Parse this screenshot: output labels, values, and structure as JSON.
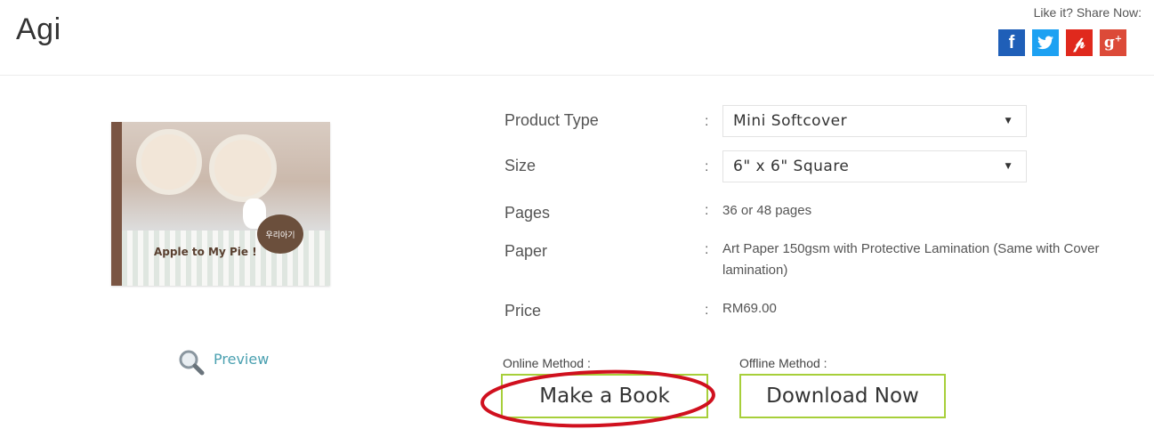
{
  "page": {
    "title": "Agi"
  },
  "share": {
    "label": "Like it? Share Now:",
    "buttons": [
      {
        "id": "facebook",
        "glyph": "f",
        "color": "#1f5fb8"
      },
      {
        "id": "twitter",
        "glyph": "t",
        "color": "#1da1f2"
      },
      {
        "id": "pinterest",
        "glyph": "P",
        "color": "#e0291d"
      },
      {
        "id": "googleplus",
        "glyph": "g+",
        "color": "#dc4a38"
      }
    ]
  },
  "cover": {
    "text": "Apple to My Pie !",
    "bubble_text": "우리아기"
  },
  "preview": {
    "label": "Preview",
    "icon": "magnifier-icon"
  },
  "specs": {
    "product_type": {
      "label": "Product Type",
      "selected": "Mini Softcover"
    },
    "size": {
      "label": "Size",
      "selected": "6\" x 6\" Square"
    },
    "pages": {
      "label": "Pages",
      "value": "36 or 48 pages"
    },
    "paper": {
      "label": "Paper",
      "value": "Art Paper 150gsm with Protective Lamination (Same with Cover lamination)"
    },
    "price": {
      "label": "Price",
      "value": "RM69.00"
    },
    "separator": ":"
  },
  "methods": {
    "online": {
      "label": "Online Method :",
      "button": "Make a Book"
    },
    "offline": {
      "label": "Offline Method :",
      "button": "Download Now"
    },
    "button_border_color": "#a7cf3a",
    "highlight_color": "#d0101e"
  }
}
